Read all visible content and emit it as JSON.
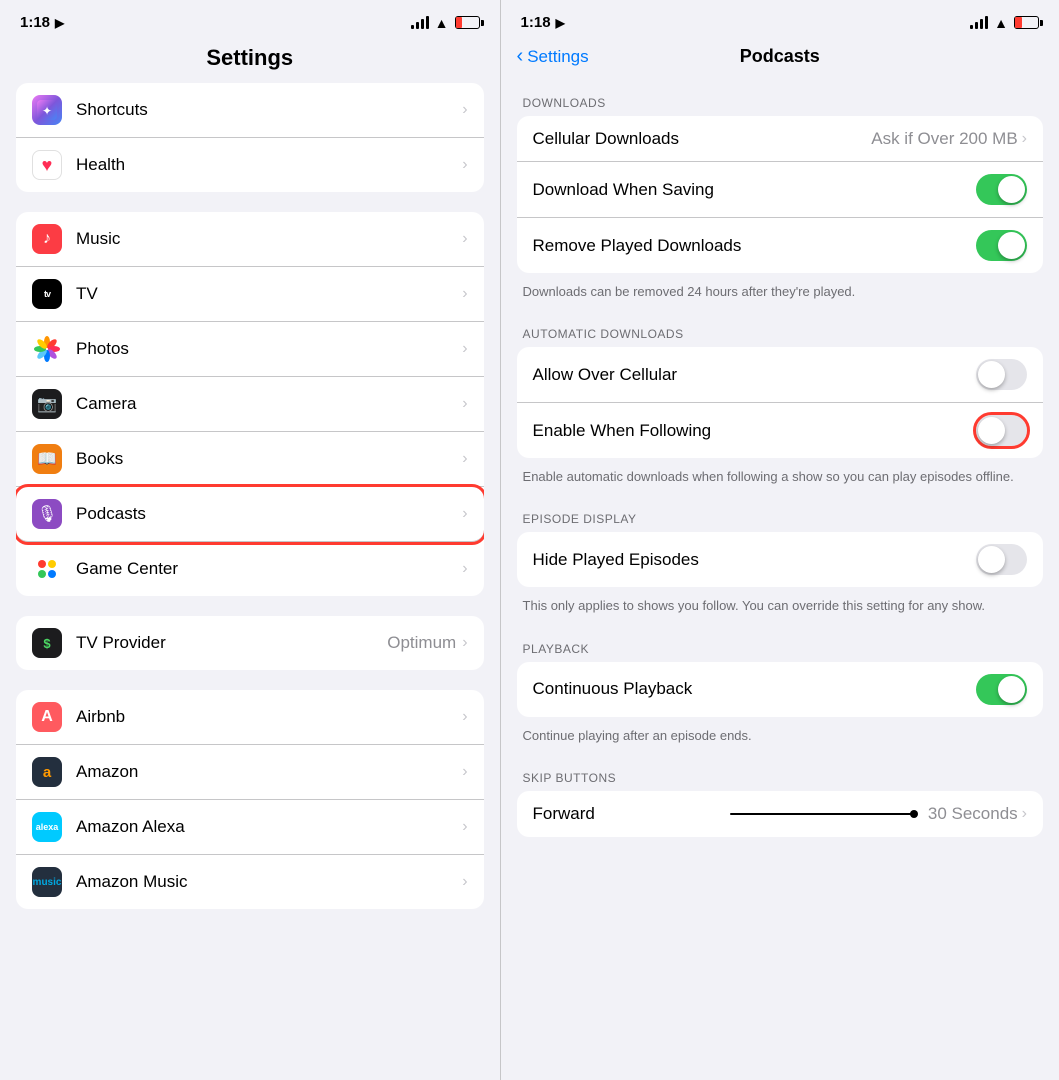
{
  "left": {
    "status": {
      "time": "1:18",
      "location_icon": "▶"
    },
    "title": "Settings",
    "groups": [
      {
        "id": "top",
        "items": [
          {
            "id": "shortcuts",
            "label": "Shortcuts",
            "icon_class": "icon-shortcuts",
            "icon_char": "⌘",
            "chevron": "›"
          },
          {
            "id": "health",
            "label": "Health",
            "icon_class": "icon-health",
            "icon_char": "❤",
            "chevron": "›"
          }
        ]
      },
      {
        "id": "media",
        "items": [
          {
            "id": "music",
            "label": "Music",
            "icon_class": "icon-music",
            "icon_char": "♪",
            "chevron": "›"
          },
          {
            "id": "tv",
            "label": "TV",
            "icon_class": "icon-tv",
            "icon_char": "TV",
            "chevron": "›"
          },
          {
            "id": "photos",
            "label": "Photos",
            "icon_class": "icon-photos",
            "icon_char": "◉",
            "chevron": "›"
          },
          {
            "id": "camera",
            "label": "Camera",
            "icon_class": "icon-camera",
            "icon_char": "◎",
            "chevron": "›"
          },
          {
            "id": "books",
            "label": "Books",
            "icon_class": "icon-books",
            "icon_char": "📖",
            "chevron": "›"
          },
          {
            "id": "podcasts",
            "label": "Podcasts",
            "icon_class": "icon-podcasts",
            "icon_char": "🎙",
            "chevron": "›",
            "highlighted": true
          },
          {
            "id": "gamecenter",
            "label": "Game Center",
            "icon_class": "icon-gamecenter",
            "icon_char": "◉",
            "chevron": "›"
          }
        ]
      },
      {
        "id": "providers",
        "items": [
          {
            "id": "tvprovider",
            "label": "TV Provider",
            "icon_class": "icon-tvprovider",
            "icon_char": "$",
            "value": "Optimum",
            "chevron": "›"
          }
        ]
      },
      {
        "id": "apps",
        "items": [
          {
            "id": "airbnb",
            "label": "Airbnb",
            "icon_class": "icon-airbnb",
            "icon_char": "A",
            "chevron": "›"
          },
          {
            "id": "amazon",
            "label": "Amazon",
            "icon_class": "icon-amazon",
            "icon_char": "a",
            "chevron": "›"
          },
          {
            "id": "amazonalexa",
            "label": "Amazon Alexa",
            "icon_class": "icon-amazonalexa",
            "icon_char": "alexa",
            "chevron": "›"
          },
          {
            "id": "amazonmusic",
            "label": "Amazon Music",
            "icon_class": "icon-amazonmusic",
            "icon_char": "music",
            "chevron": "›"
          }
        ]
      }
    ]
  },
  "right": {
    "status": {
      "time": "1:18",
      "location_icon": "▶"
    },
    "back_label": "Settings",
    "title": "Podcasts",
    "sections": [
      {
        "id": "downloads",
        "header": "DOWNLOADS",
        "items": [
          {
            "id": "cellular-downloads",
            "type": "chevron",
            "label": "Cellular Downloads",
            "value": "Ask if Over 200 MB"
          },
          {
            "id": "download-when-saving",
            "type": "toggle",
            "label": "Download When Saving",
            "state": "on"
          },
          {
            "id": "remove-played-downloads",
            "type": "toggle",
            "label": "Remove Played Downloads",
            "state": "on"
          }
        ],
        "helper": "Downloads can be removed 24 hours after they're played."
      },
      {
        "id": "automatic-downloads",
        "header": "AUTOMATIC DOWNLOADS",
        "items": [
          {
            "id": "allow-over-cellular",
            "type": "toggle",
            "label": "Allow Over Cellular",
            "state": "off"
          },
          {
            "id": "enable-when-following",
            "type": "toggle",
            "label": "Enable When Following",
            "state": "off",
            "highlighted": true
          }
        ],
        "helper": "Enable automatic downloads when following a show so you can play episodes offline."
      },
      {
        "id": "episode-display",
        "header": "EPISODE DISPLAY",
        "items": [
          {
            "id": "hide-played-episodes",
            "type": "toggle",
            "label": "Hide Played Episodes",
            "state": "off"
          }
        ],
        "helper": "This only applies to shows you follow. You can override this setting for any show."
      },
      {
        "id": "playback",
        "header": "PLAYBACK",
        "items": [
          {
            "id": "continuous-playback",
            "type": "toggle",
            "label": "Continuous Playback",
            "state": "on"
          }
        ],
        "helper": "Continue playing after an episode ends."
      },
      {
        "id": "skip-buttons",
        "header": "SKIP BUTTONS",
        "items": [
          {
            "id": "forward",
            "type": "chevron",
            "label": "Forward",
            "value": "30 Seconds"
          }
        ]
      }
    ]
  }
}
